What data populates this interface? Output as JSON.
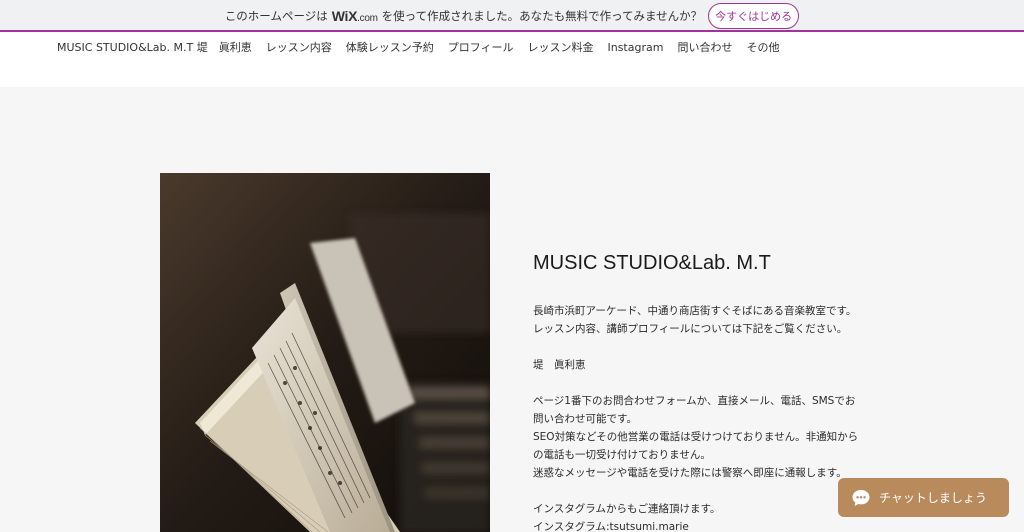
{
  "banner": {
    "prefix": "このホームページは",
    "wix_brand": "WiX",
    "wix_suffix": ".com",
    "suffix": "を使って作成されました。あなたも無料で作ってみませんか？",
    "cta_label": "今すぐはじめる"
  },
  "nav": {
    "items": [
      {
        "label": "MUSIC STUDIO&Lab. M.T 堤　眞利恵"
      },
      {
        "label": "レッスン内容"
      },
      {
        "label": "体験レッスン予約"
      },
      {
        "label": "プロフィール"
      },
      {
        "label": "レッスン料金"
      },
      {
        "label": "Instagram"
      },
      {
        "label": "問い合わせ"
      },
      {
        "label": "その他"
      }
    ]
  },
  "hero": {
    "title": "MUSIC STUDIO&Lab. M.T",
    "lines": [
      "長崎市浜町アーケード、中通り商店街すぐそばにある音楽教室です。",
      "レッスン内容、講師プロフィールについては下記をご覧ください。",
      "",
      "堤　眞利恵",
      "",
      "ページ1番下のお問合わせフォームか、直接メール、電話、SMSでお問い合わせ可能です。",
      "SEO対策などその他営業の電話は受けつけておりません。非通知からの電話も一切受け付けておりません。",
      "迷惑なメッセージや電話を受けた際には警察へ即座に通報します。",
      "",
      "インスタグラムからもご連絡頂けます。",
      "インスタグラム:tsutsumi.marie"
    ]
  },
  "chat": {
    "label": "チャットしましょう",
    "color": "#b98a5c"
  },
  "colors": {
    "wix_accent": "#a0349b",
    "page_bg": "#f6f6f6"
  },
  "icons": {
    "chat": "chat-bubble-icon"
  }
}
